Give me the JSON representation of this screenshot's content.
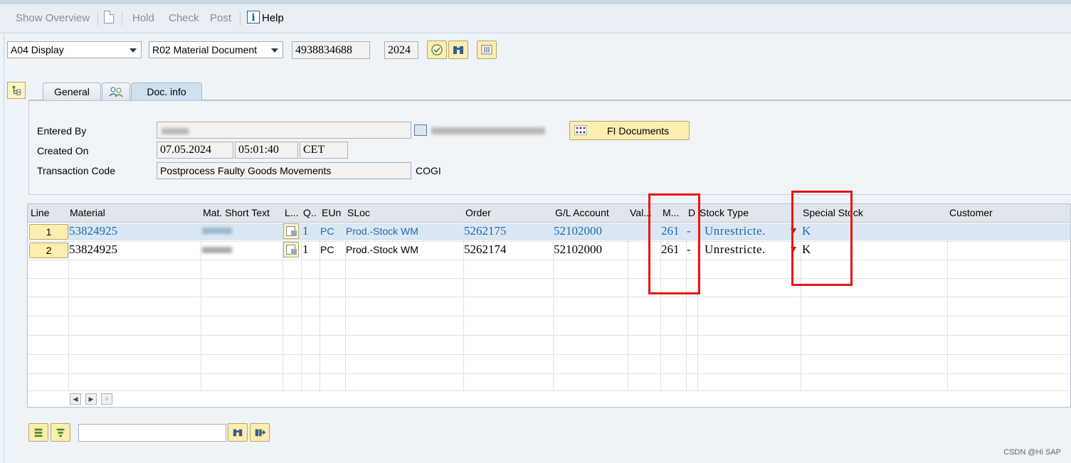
{
  "toolbar": {
    "show_overview": "Show Overview",
    "hold": "Hold",
    "check": "Check",
    "post": "Post",
    "help": "Help"
  },
  "header": {
    "action_select": "A04 Display",
    "ref_select": "R02 Material Document",
    "document_number": "4938834688",
    "year": "2024"
  },
  "tabs": [
    {
      "label": "General"
    },
    {
      "label": ""
    },
    {
      "label": "Doc. info"
    }
  ],
  "doc_info": {
    "entered_by_label": "Entered By",
    "created_on_label": "Created On",
    "created_date": "07.05.2024",
    "created_time": "05:01:40",
    "timezone": "CET",
    "transaction_code_label": "Transaction Code",
    "transaction_text": "Postprocess Faulty Goods Movements",
    "transaction_code": "COGI",
    "fi_documents": "FI Documents"
  },
  "grid": {
    "columns": [
      "Line",
      "Material",
      "Mat. Short Text",
      "L...",
      "Q..",
      "EUn",
      "SLoc",
      "Order",
      "G/L Account",
      "Val...",
      "M...",
      "D",
      "Stock Type",
      "Special Stock",
      "Customer"
    ],
    "rows": [
      {
        "line": "1",
        "material": "53824925",
        "qty": "1",
        "eun": "PC",
        "sloc": "Prod.-Stock WM",
        "order": "5262175",
        "gl": "52102000",
        "mvt": "261",
        "d": "-",
        "stock_type": "Unrestricte.",
        "special": "K"
      },
      {
        "line": "2",
        "material": "53824925",
        "qty": "1",
        "eun": "PC",
        "sloc": "Prod.-Stock WM",
        "order": "5262174",
        "gl": "52102000",
        "mvt": "261",
        "d": "-",
        "stock_type": "Unrestricte.",
        "special": "K"
      }
    ]
  },
  "watermark": "CSDN @Hi SAP",
  "colors": {
    "highlight_box": "#e81515",
    "link": "#1c6bb0",
    "button_yellow": "#fdeeb0"
  }
}
